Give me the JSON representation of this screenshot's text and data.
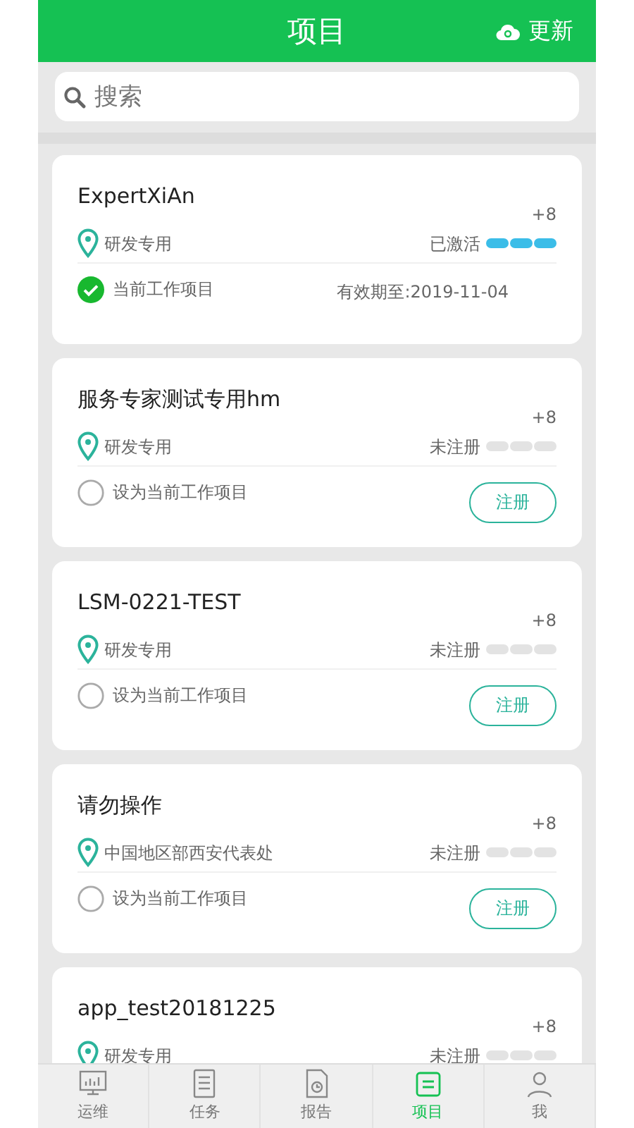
{
  "header": {
    "title": "项目",
    "action": "更新"
  },
  "search": {
    "placeholder": "搜索"
  },
  "projects": [
    {
      "name": "ExpertXiAn",
      "count": "+8",
      "location": "研发专用",
      "status": "已激活",
      "activated": true,
      "current": true,
      "current_label": "当前工作项目",
      "expiry": "有效期至:2019-11-04"
    },
    {
      "name": "服务专家测试专用hm",
      "count": "+8",
      "location": "研发专用",
      "status": "未注册",
      "activated": false,
      "current": false,
      "current_label": "设为当前工作项目",
      "button": "注册"
    },
    {
      "name": "LSM-0221-TEST",
      "count": "+8",
      "location": "研发专用",
      "status": "未注册",
      "activated": false,
      "current": false,
      "current_label": "设为当前工作项目",
      "button": "注册"
    },
    {
      "name": "请勿操作",
      "count": "+8",
      "location": "中国地区部西安代表处",
      "status": "未注册",
      "activated": false,
      "current": false,
      "current_label": "设为当前工作项目",
      "button": "注册"
    },
    {
      "name": "app_test20181225",
      "count": "+8",
      "location": "研发专用",
      "status": "未注册",
      "activated": false
    }
  ],
  "tabs": [
    {
      "label": "运维",
      "kind": "monitor",
      "selected": false
    },
    {
      "label": "任务",
      "kind": "list",
      "selected": false
    },
    {
      "label": "报告",
      "kind": "report",
      "selected": false
    },
    {
      "label": "项目",
      "kind": "project",
      "selected": true
    },
    {
      "label": "我",
      "kind": "person",
      "selected": false
    }
  ]
}
